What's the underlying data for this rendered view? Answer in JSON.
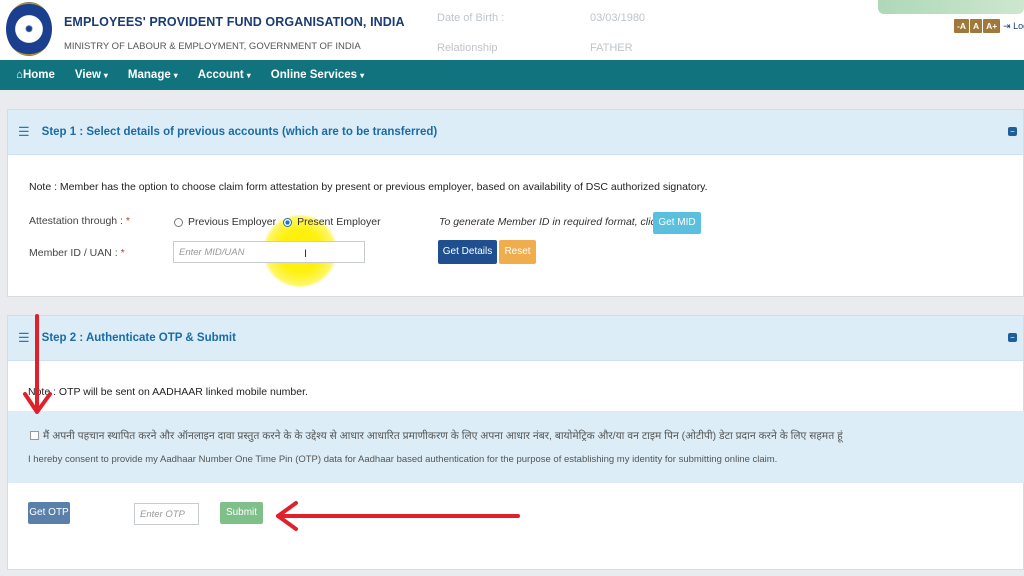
{
  "header": {
    "org_name": "EMPLOYEES' PROVIDENT FUND ORGANISATION, INDIA",
    "ministry": "MINISTRY OF LABOUR & EMPLOYMENT, GOVERNMENT OF INDIA",
    "faded_dob_label": "Date of Birth :",
    "faded_dob_value": "03/03/1980",
    "faded_rel_label": "Relationship",
    "faded_rel_value": "FATHER",
    "font_small": "-A",
    "font_normal": "A",
    "font_large": "A+",
    "logout": "Logout"
  },
  "nav": {
    "home": "Home",
    "view": "View",
    "manage": "Manage",
    "account": "Account",
    "online_services": "Online Services"
  },
  "step1": {
    "title": "Step 1 : Select details of previous accounts (which are to be transferred)",
    "note": "Note : Member has the option to choose claim form attestation by present or previous employer, based on availability of DSC authorized signatory.",
    "attestation_label": "Attestation through :",
    "previous_employer": "Previous Employer",
    "present_employer": "Present Employer",
    "member_id_label": "Member ID / UAN :",
    "member_id_placeholder": "Enter MID/UAN",
    "generate_text": "To generate Member ID in required format, click",
    "get_mid": "Get MID",
    "get_details": "Get Details",
    "reset": "Reset"
  },
  "step2": {
    "title": "Step 2 : Authenticate OTP & Submit",
    "note": "Note : OTP will be sent on AADHAAR linked mobile number.",
    "consent_hindi": "मैं अपनी पहचान स्थापित करने और ऑनलाइन दावा प्रस्तुत करने के के उद्देश्य से आधार आधारित प्रमाणीकरण के लिए अपना आधार नंबर, बायोमेट्रिक और/या वन टाइम पिन (ओटीपी) डेटा प्रदान करने के लिए सहमत हूं",
    "consent_english": "I hereby consent to provide my Aadhaar Number One Time Pin (OTP) data for Aadhaar based authentication for the purpose of establishing my identity for submitting online claim.",
    "get_otp": "Get OTP",
    "otp_placeholder": "Enter OTP",
    "submit": "Submit"
  },
  "colors": {
    "navbar": "#11737d",
    "panel_header": "#dcedf7",
    "get_mid": "#5bc0de",
    "get_details": "#1f4f8f",
    "reset": "#f0ad4e",
    "get_otp": "#5a7fa8",
    "submit": "#7fbf8a",
    "annotation_arrow": "#e0202a"
  }
}
